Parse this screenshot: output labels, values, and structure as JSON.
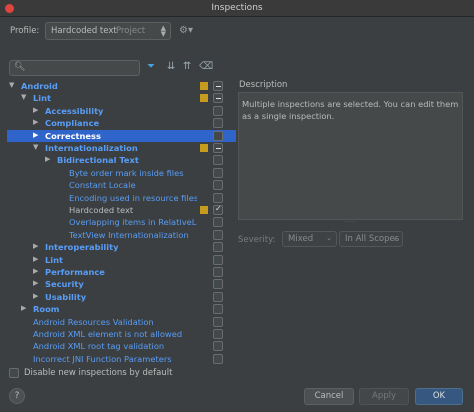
{
  "window": {
    "title": "Inspections"
  },
  "profile": {
    "label": "Profile:",
    "name": "Hardcoded text",
    "scope": "Project"
  },
  "search": {
    "value": "",
    "placeholder": ""
  },
  "tree": [
    {
      "label": "Android",
      "arrow": "▼",
      "indent": 0,
      "style": "blue bold",
      "sev": true,
      "cb": "mixed"
    },
    {
      "label": "Lint",
      "arrow": "▼",
      "indent": 1,
      "style": "blue bold",
      "sev": true,
      "cb": "mixed"
    },
    {
      "label": "Accessibility",
      "arrow": "▶",
      "indent": 2,
      "style": "blue bold",
      "sev": false,
      "cb": ""
    },
    {
      "label": "Compliance",
      "arrow": "▶",
      "indent": 2,
      "style": "blue bold",
      "sev": false,
      "cb": ""
    },
    {
      "label": "Correctness",
      "arrow": "▶",
      "indent": 2,
      "style": "blue bold",
      "sev": false,
      "cb": "",
      "selected": true
    },
    {
      "label": "Internationalization",
      "arrow": "▼",
      "indent": 2,
      "style": "blue bold",
      "sev": true,
      "cb": "mixed"
    },
    {
      "label": "Bidirectional Text",
      "arrow": "▶",
      "indent": 3,
      "style": "blue bold",
      "sev": false,
      "cb": ""
    },
    {
      "label": "Byte order mark inside files",
      "arrow": "",
      "indent": 4,
      "style": "blue",
      "sev": false,
      "cb": ""
    },
    {
      "label": "Constant Locale",
      "arrow": "",
      "indent": 4,
      "style": "blue",
      "sev": false,
      "cb": ""
    },
    {
      "label": "Encoding used in resource files is r",
      "arrow": "",
      "indent": 4,
      "style": "blue",
      "sev": false,
      "cb": ""
    },
    {
      "label": "Hardcoded text",
      "arrow": "",
      "indent": 4,
      "style": "plain",
      "sev": true,
      "cb": "checked"
    },
    {
      "label": "Overlapping items in RelativeLayou",
      "arrow": "",
      "indent": 4,
      "style": "blue",
      "sev": false,
      "cb": ""
    },
    {
      "label": "TextView Internationalization",
      "arrow": "",
      "indent": 4,
      "style": "blue",
      "sev": false,
      "cb": ""
    },
    {
      "label": "Interoperability",
      "arrow": "▶",
      "indent": 2,
      "style": "blue bold",
      "sev": false,
      "cb": ""
    },
    {
      "label": "Lint",
      "arrow": "▶",
      "indent": 2,
      "style": "blue bold",
      "sev": false,
      "cb": ""
    },
    {
      "label": "Performance",
      "arrow": "▶",
      "indent": 2,
      "style": "blue bold",
      "sev": false,
      "cb": ""
    },
    {
      "label": "Security",
      "arrow": "▶",
      "indent": 2,
      "style": "blue bold",
      "sev": false,
      "cb": ""
    },
    {
      "label": "Usability",
      "arrow": "▶",
      "indent": 2,
      "style": "blue bold",
      "sev": false,
      "cb": ""
    },
    {
      "label": "Room",
      "arrow": "▶",
      "indent": 1,
      "style": "blue bold",
      "sev": false,
      "cb": ""
    },
    {
      "label": "Android Resources Validation",
      "arrow": "",
      "indent": 1,
      "style": "blue",
      "sev": false,
      "cb": ""
    },
    {
      "label": "Android XML element is not allowed",
      "arrow": "",
      "indent": 1,
      "style": "blue",
      "sev": false,
      "cb": ""
    },
    {
      "label": "Android XML root tag validation",
      "arrow": "",
      "indent": 1,
      "style": "blue",
      "sev": false,
      "cb": ""
    },
    {
      "label": "Incorrect JNI Function Parameters",
      "arrow": "",
      "indent": 1,
      "style": "blue",
      "sev": false,
      "cb": ""
    }
  ],
  "description": {
    "title": "Description",
    "text": "Multiple inspections are selected. You can edit them as a single inspection."
  },
  "severity": {
    "label": "Severity:",
    "value": "Mixed",
    "scope": "In All Scopes"
  },
  "disable_new": {
    "label": "Disable new inspections by default"
  },
  "buttons": {
    "help": "?",
    "cancel": "Cancel",
    "apply": "Apply",
    "ok": "OK"
  },
  "colors": {
    "accent": "#2f65ca",
    "link": "#589df6",
    "severity": "#c69b1e",
    "ok": "#365880"
  }
}
